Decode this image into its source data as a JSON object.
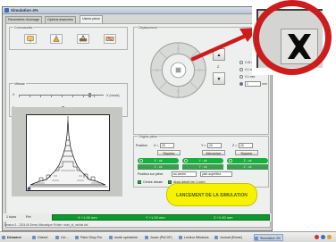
{
  "window": {
    "title": "Simulation 4%",
    "tabs": [
      "Paramètres d'usinage",
      "Options avancées",
      "Usiner pièce"
    ]
  },
  "groups": {
    "commandes": "Commandes",
    "deplacement": "Déplacement",
    "vitesse": "Vitesse",
    "origine": "Origine pièce"
  },
  "speed": {
    "v_label": "V (mm/s)",
    "q_label": "Qté moteur",
    "left_val": "X",
    "left_val2": "2"
  },
  "axis": {
    "z_label": "Z",
    "step_options": [
      "0.01 mm",
      "0.1 mm",
      "0.1 mm",
      "1 mm"
    ],
    "step_value": "1",
    "step_unit": "mm"
  },
  "origin": {
    "position_label": "Position",
    "x_label": "X =",
    "y_label": "Y =",
    "z_label": "Z =",
    "x_value": "20",
    "y_value": "20",
    "z_value": "20",
    "repeter_x": "Repérer",
    "repeter_y": "Mémoriser",
    "repeter_z": "Repérer",
    "pills": [
      "X : ok",
      "Y : ok",
      "Z : ok"
    ],
    "pills2": [
      "X : ok",
      "Y : ok",
      "Z : ok"
    ],
    "origin_label": "Position sur pièce",
    "origin_select": "au centre",
    "corner_select": "plan supérieur",
    "check1": "Centre dessin",
    "check2": "Ajout dépôt (en 1 mm)"
  },
  "launch": {
    "label": "LANCEMENT DE LA SIMULATION"
  },
  "coords": {
    "left_a": "1 tours",
    "left_b": "Pré",
    "x": "X   +1.00 mm",
    "y": "Y   +1.00 mm",
    "z": "Z   +1.00 mm"
  },
  "status": {
    "text": "Version 3 - 2024-06 Demo        Mécanique         Fichier: mont_st_michel.dxf"
  },
  "taskbar": {
    "items": [
      "Démarrer",
      "Gdesel",
      "Ovi ...",
      "Paint Shop Pro",
      "mode opératoire",
      "Jouez (PhCVF)",
      "Lecteur Windows",
      "Journal (Rome)",
      "Simulation 4%"
    ]
  },
  "colors": {
    "accent_green": "#16b03c",
    "launch_yellow": "#f7f300",
    "callout_red": "#cd1c1c"
  },
  "icons": [
    "drill-icon",
    "tool-icon",
    "engrave-icon",
    "cut-icon",
    "home-icon",
    "close-icon"
  ]
}
